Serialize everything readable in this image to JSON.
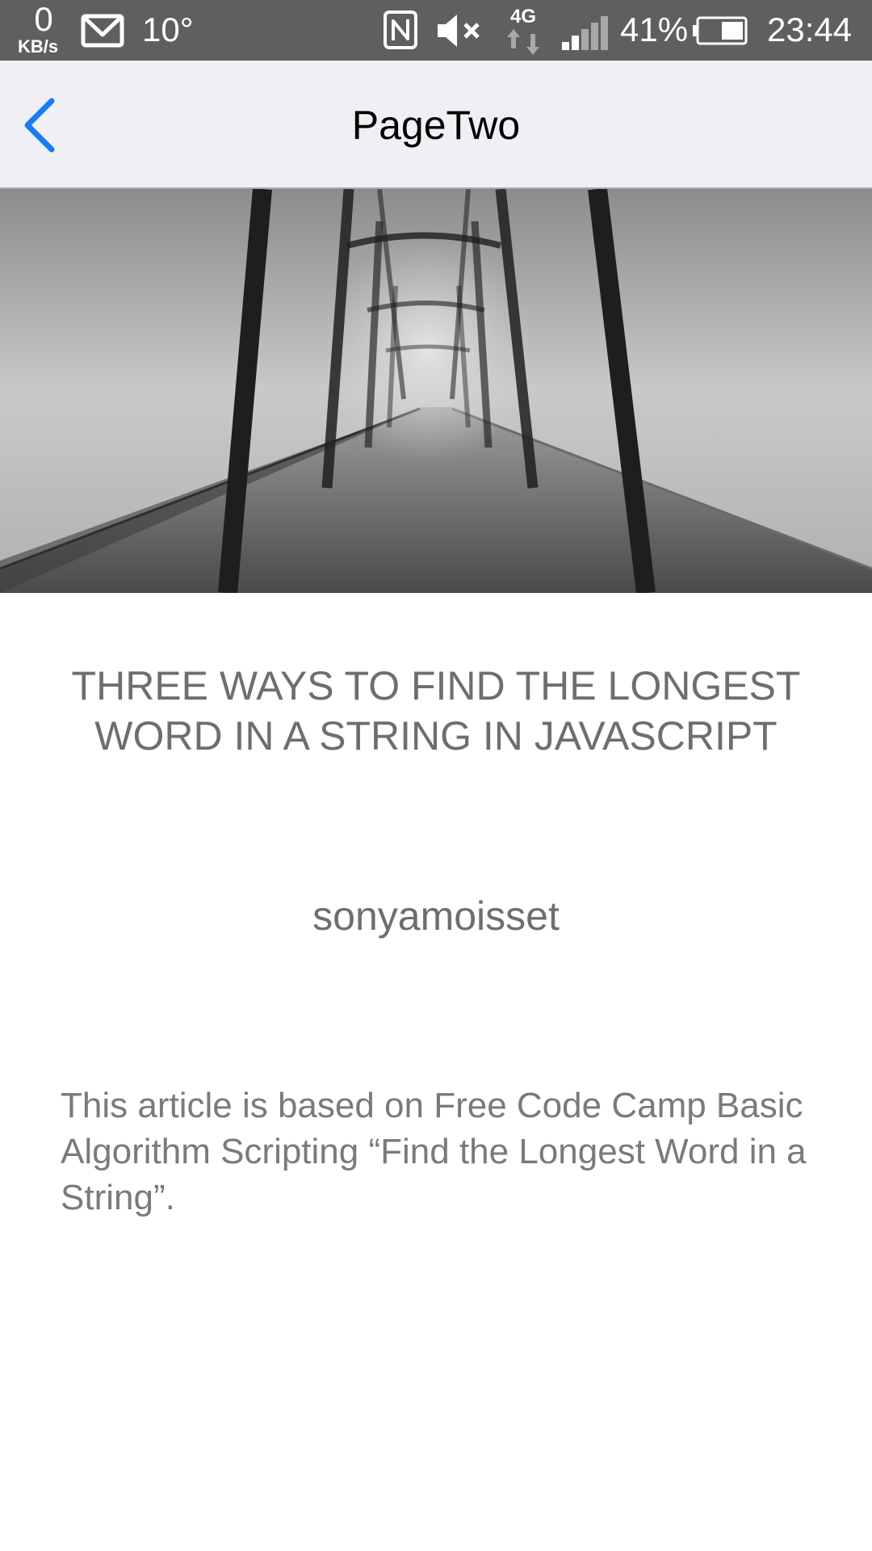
{
  "status_bar": {
    "network_speed": "0",
    "network_speed_unit": "KB/s",
    "temperature": "10°",
    "network_type": "4G",
    "battery_percent": "41%",
    "time": "23:44"
  },
  "nav": {
    "title": "PageTwo",
    "back_icon": "chevron-left-icon",
    "accent_color": "#1a7cf5"
  },
  "article": {
    "title": "THREE WAYS TO FIND THE LONGEST WORD IN A STRING IN JAVASCRIPT",
    "author": "sonyamoisset",
    "body": "This article is based on Free Code Camp Basic Algorithm Scripting “Find the Longest Word in a String”."
  }
}
